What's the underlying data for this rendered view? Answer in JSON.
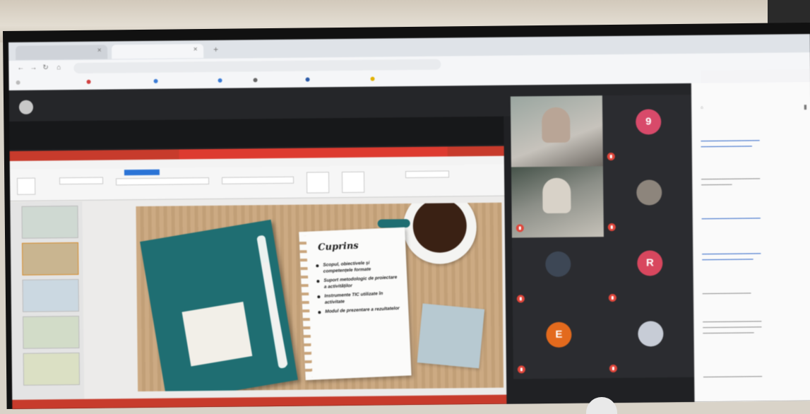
{
  "browser": {
    "tabs": [
      {
        "label": ""
      },
      {
        "label": ""
      }
    ],
    "url": ""
  },
  "meet": {
    "header_title": "",
    "participants": [
      {
        "initial": "9",
        "name": "",
        "color": "#d84a6a",
        "kind": "initial"
      },
      {
        "initial": "",
        "name": "",
        "kind": "video1"
      },
      {
        "initial": "",
        "name": "",
        "kind": "photo"
      },
      {
        "initial": "",
        "name": "",
        "kind": "video2"
      },
      {
        "initial": "R",
        "name": "",
        "color": "#d8475e",
        "kind": "initial"
      },
      {
        "initial": "",
        "name": "",
        "kind": "photo"
      },
      {
        "initial": "",
        "name": "",
        "kind": "photo"
      },
      {
        "initial": "E",
        "name": "",
        "color": "#e36a1d",
        "kind": "initial"
      }
    ]
  },
  "slide": {
    "title": "Cuprins",
    "items": [
      "Scopul, obiectivele și competențele formate",
      "Suport metodologic de proiectare a activităților",
      "Instrumente TIC utilizate în activitate",
      "Modul de prezentare a rezultatelor"
    ]
  },
  "colors": {
    "ppt_red": "#c73b2c",
    "folder_teal": "#1f6e72",
    "meet_bg": "#202124",
    "mic_red": "#e0463b"
  }
}
